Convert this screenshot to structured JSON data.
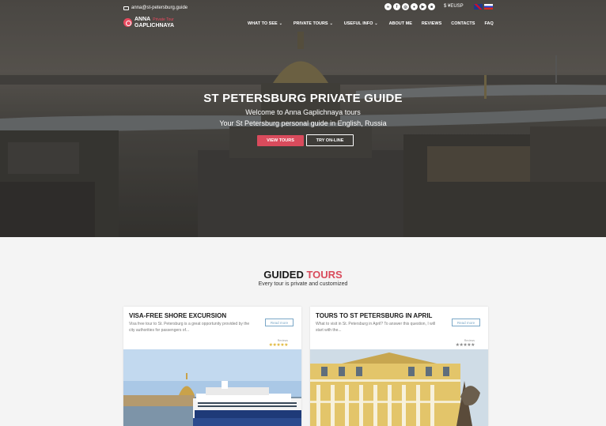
{
  "header": {
    "email": "anna@st-petersburg.guide",
    "social_icons": [
      "tripadvisor-icon",
      "facebook-icon",
      "instagram-icon",
      "vk-icon",
      "youtube-icon",
      "camera-icon"
    ],
    "currency": "$ ¥EUSP",
    "languages": [
      "en",
      "ru"
    ]
  },
  "logo": {
    "first_name": "ANNA",
    "tagline": "Private Tour",
    "last_name": "GAPLICHNAYA"
  },
  "nav": {
    "items": [
      {
        "label": "WHAT TO SEE",
        "has_dropdown": true
      },
      {
        "label": "PRIVATE TOURS",
        "has_dropdown": true
      },
      {
        "label": "USEFUL INFO",
        "has_dropdown": true
      },
      {
        "label": "ABOUT ME",
        "has_dropdown": false
      },
      {
        "label": "REVIEWS",
        "has_dropdown": false
      },
      {
        "label": "CONTACTS",
        "has_dropdown": false
      },
      {
        "label": "FAQ",
        "has_dropdown": false
      }
    ]
  },
  "hero": {
    "title": "ST PETERSBURG PRIVATE GUIDE",
    "subtitle1": "Welcome to Anna Gaplichnaya tours",
    "subtitle2": "Your St Petersburg personal guide in English, Russia",
    "primary_button": "VIEW TOURS",
    "secondary_button": "TRY ON-LINE"
  },
  "section": {
    "title_main": "GUIDED ",
    "title_accent": "TOURS",
    "subtitle": "Every tour is private and customized"
  },
  "cards": [
    {
      "title": "VISA-FREE SHORE EXCURSION",
      "text": "Visa free tour to St. Petersburg is a great opportunity provided by the city authorities for passengers of...",
      "button": "Read more",
      "rating_label": "Reviews",
      "stars": "★★★★★"
    },
    {
      "title": "TOURS TO ST PETERSBURG IN APRIL",
      "text": "What to visit in St. Petersburg in April? To answer this question, I will start with the...",
      "button": "Read more",
      "rating_label": "Reviews",
      "stars": "★★★★★"
    }
  ],
  "colors": {
    "accent": "#d94b5c",
    "link": "#7aa7c7",
    "stars": "#e0b73a"
  }
}
